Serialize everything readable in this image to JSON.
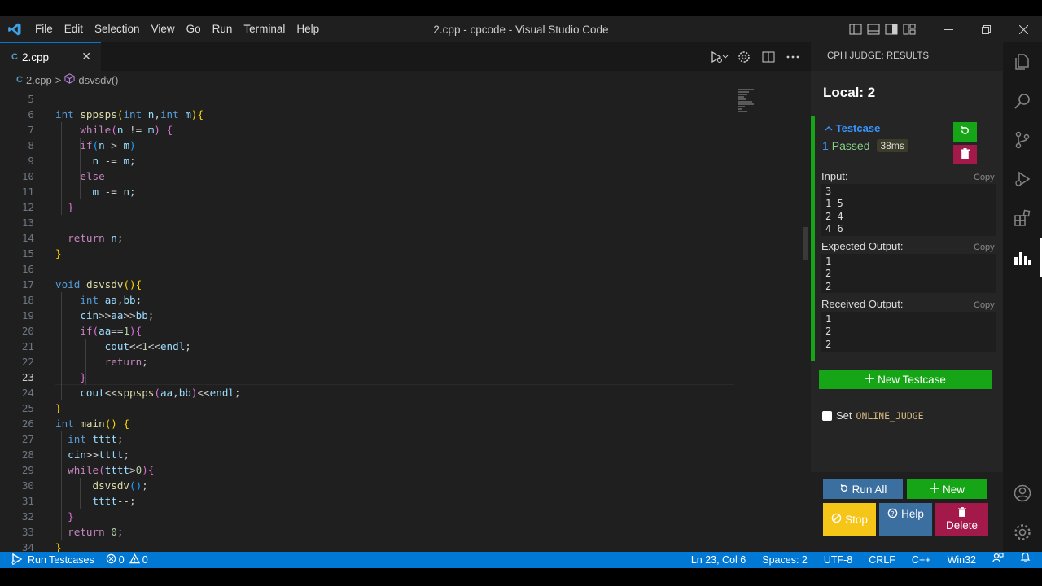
{
  "window": {
    "title": "2.cpp - cpcode - Visual Studio Code",
    "menu": [
      "File",
      "Edit",
      "Selection",
      "View",
      "Go",
      "Run",
      "Terminal",
      "Help"
    ]
  },
  "tab": {
    "label": "2.cpp",
    "lang_glyph": "C",
    "close": "✕"
  },
  "breadcrumbs": {
    "file": "2.cpp",
    "separator": ">",
    "symbol": "dsvsdv()"
  },
  "editor": {
    "lines": [
      {
        "n": "5",
        "code": ""
      },
      {
        "n": "6",
        "code": "int sppsps(int n,int m){"
      },
      {
        "n": "7",
        "code": "    while(n != m) {"
      },
      {
        "n": "8",
        "code": "    if(n > m)"
      },
      {
        "n": "9",
        "code": "      n -= m;"
      },
      {
        "n": "10",
        "code": "    else"
      },
      {
        "n": "11",
        "code": "      m -= n;"
      },
      {
        "n": "12",
        "code": "  }"
      },
      {
        "n": "13",
        "code": ""
      },
      {
        "n": "14",
        "code": "  return n;"
      },
      {
        "n": "15",
        "code": "}"
      },
      {
        "n": "16",
        "code": ""
      },
      {
        "n": "17",
        "code": "void dsvsdv(){"
      },
      {
        "n": "18",
        "code": "    int aa,bb;"
      },
      {
        "n": "19",
        "code": "    cin>>aa>>bb;"
      },
      {
        "n": "20",
        "code": "    if(aa==1){"
      },
      {
        "n": "21",
        "code": "        cout<<1<<endl;"
      },
      {
        "n": "22",
        "code": "        return;"
      },
      {
        "n": "23",
        "code": "    }"
      },
      {
        "n": "24",
        "code": "    cout<<sppsps(aa,bb)<<endl;"
      },
      {
        "n": "25",
        "code": "}"
      },
      {
        "n": "26",
        "code": "int main() {"
      },
      {
        "n": "27",
        "code": "  int tttt;"
      },
      {
        "n": "28",
        "code": "  cin>>tttt;"
      },
      {
        "n": "29",
        "code": "  while(tttt>0){"
      },
      {
        "n": "30",
        "code": "      dsvsdv();"
      },
      {
        "n": "31",
        "code": "      tttt--;"
      },
      {
        "n": "32",
        "code": "  }"
      },
      {
        "n": "33",
        "code": "  return 0;"
      },
      {
        "n": "34",
        "code": "}"
      }
    ],
    "current_line": "23"
  },
  "cph": {
    "header": "CPH JUDGE: RESULTS",
    "local": "Local: 2",
    "testcase": {
      "title": "Testcase",
      "num": "1",
      "status": "Passed",
      "time": "38ms",
      "input_label": "Input:",
      "input": "3\n1 5\n2 4\n4 6",
      "expected_label": "Expected Output:",
      "expected": "1\n2\n2",
      "received_label": "Received Output:",
      "received": "1\n2\n2",
      "copy": "Copy"
    },
    "new_testcase": "New Testcase",
    "oj_label": "Set",
    "oj_code": "ONLINE_JUDGE",
    "footer": {
      "run_all": "Run All",
      "new": "New",
      "stop": "Stop",
      "help": "Help",
      "delete": "Delete"
    }
  },
  "status_bar": {
    "run_testcases": "Run Testcases",
    "errors": "0",
    "warnings": "0",
    "position": "Ln 23, Col 6",
    "spaces": "Spaces: 2",
    "encoding": "UTF-8",
    "eol": "CRLF",
    "language": "C++",
    "platform": "Win32"
  },
  "colors": {
    "accent": "#0078d4",
    "pass_green": "#16a516",
    "delete_red": "#a31a4a",
    "stop_yellow": "#f5c518",
    "help_blue": "#3a6fa0"
  }
}
